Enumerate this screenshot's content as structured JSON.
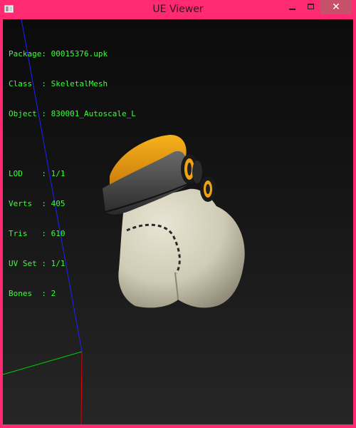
{
  "window": {
    "title": "UE Viewer",
    "close_symbol": "✕"
  },
  "info": {
    "package": {
      "label": "Package:",
      "value": "00015376.upk"
    },
    "class": {
      "label": "Class  :",
      "value": "SkeletalMesh"
    },
    "object": {
      "label": "Object :",
      "value": "830001_Autoscale_L"
    },
    "lod": {
      "label": "LOD    :",
      "value": "1/1"
    },
    "verts": {
      "label": "Verts  :",
      "value": "405"
    },
    "tris": {
      "label": "Tris   :",
      "value": "610"
    },
    "uvset": {
      "label": "UV Set :",
      "value": "1/1"
    },
    "bones": {
      "label": "Bones  :",
      "value": "2"
    }
  },
  "colors": {
    "title_bar": "#ff2a72",
    "info_text": "#39ff39",
    "axis_x": "#ff0000",
    "axis_y": "#00d000",
    "axis_z": "#2020ff"
  }
}
